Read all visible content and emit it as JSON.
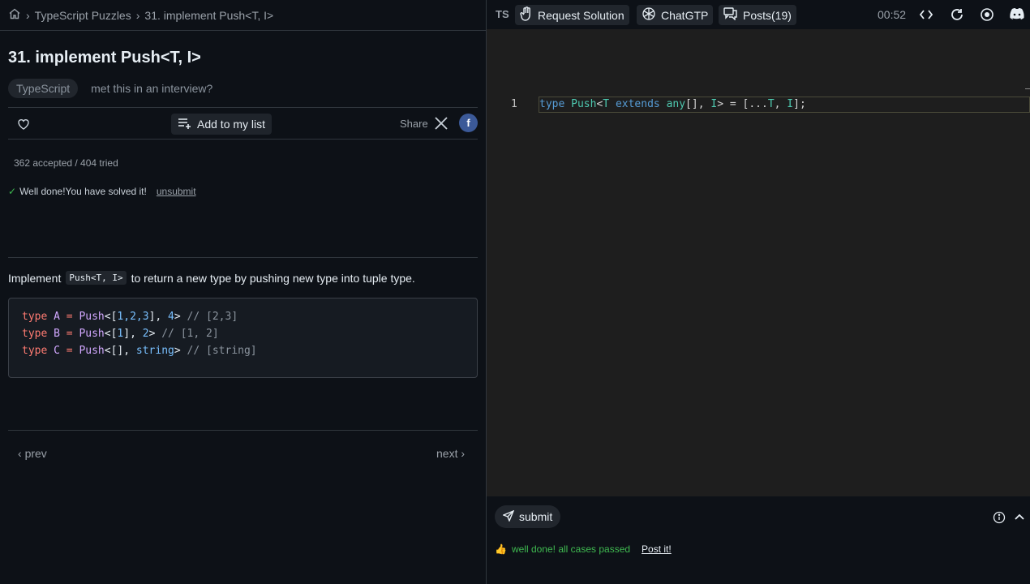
{
  "breadcrumb": {
    "root_icon": "home-icon",
    "section": "TypeScript Puzzles",
    "current": "31. implement Push<T, I>"
  },
  "problem": {
    "title": "31. implement Push<T, I>",
    "tag": "TypeScript",
    "interview_link": "met this in an interview?"
  },
  "actions": {
    "add_to_list": "Add to my list",
    "share_label": "Share",
    "fb_label": "f"
  },
  "stats": {
    "text": "362 accepted / 404 tried",
    "solved_text": "Well done!You have solved it!",
    "unsubmit": "unsubmit"
  },
  "description": {
    "before": "Implement",
    "code": "Push<T, I>",
    "after": "to return a new type by pushing new type into tuple type."
  },
  "examples": [
    {
      "kw": "type",
      "name": "A",
      "eq": "=",
      "fn": "Push",
      "args_open": "<[",
      "nums": "1,2,3",
      "args_mid": "], ",
      "arg2": "4",
      "close": ">",
      "comment": "// [2,3]"
    },
    {
      "kw": "type",
      "name": "B",
      "eq": "=",
      "fn": "Push",
      "args_open": "<[",
      "nums": "1",
      "args_mid": "], ",
      "arg2": "2",
      "close": ">",
      "comment": "// [1, 2]"
    },
    {
      "kw": "type",
      "name": "C",
      "eq": "=",
      "fn": "Push",
      "args_open": "<[",
      "nums": "",
      "args_mid": "], ",
      "arg2": "string",
      "close": ">",
      "comment": "// [string]"
    }
  ],
  "nav": {
    "prev": "prev",
    "next": "next"
  },
  "toolbar": {
    "lang": "TS",
    "request_solution": "Request Solution",
    "chatgpt": "ChatGTP",
    "posts": "Posts(19)",
    "timer": "00:52"
  },
  "editor": {
    "line_number": "1",
    "code": {
      "t1": "type",
      "t2": "Push",
      "t3": "<",
      "t4": "T",
      "t5": "extends",
      "t6": "any",
      "t7": "[], ",
      "t8": "I",
      "t9": "> = [...",
      "t10": "T",
      "t11": ", ",
      "t12": "I",
      "t13": "];"
    }
  },
  "footer": {
    "submit": "submit",
    "result": "well done! all cases passed",
    "post_it": "Post it!"
  }
}
